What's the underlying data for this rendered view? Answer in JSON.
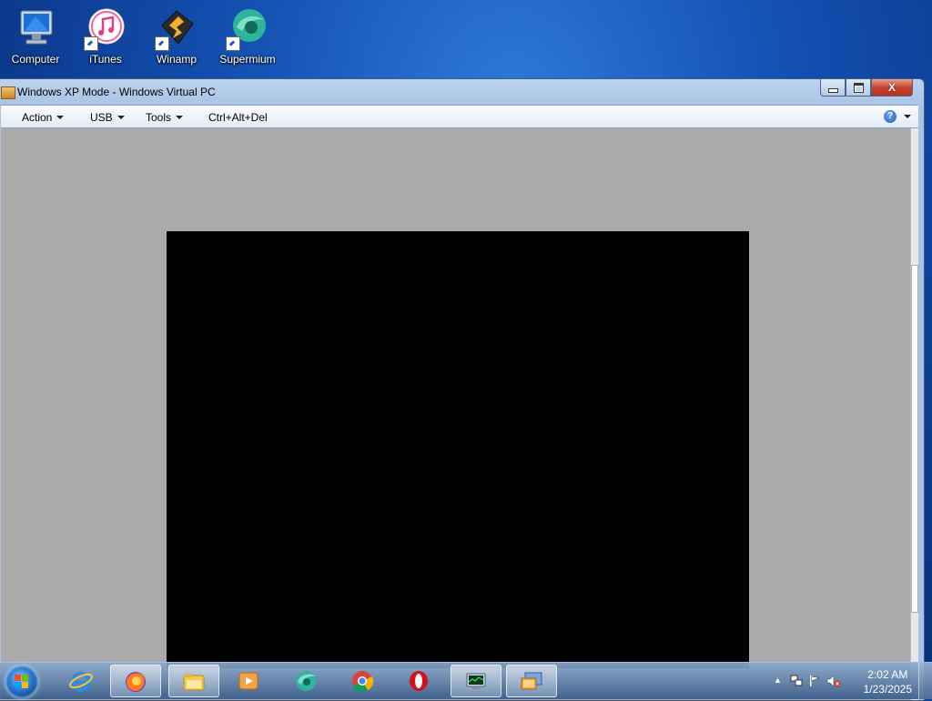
{
  "desktop": {
    "icons": [
      {
        "label": "Computer"
      },
      {
        "label": "iTunes"
      },
      {
        "label": "Winamp"
      },
      {
        "label": "Supermium"
      }
    ]
  },
  "window": {
    "title": "Windows XP Mode - Windows Virtual PC",
    "menu": {
      "action": "Action",
      "usb": "USB",
      "tools": "Tools",
      "cad": "Ctrl+Alt+Del"
    },
    "help_symbol": "?",
    "close_symbol": "X"
  },
  "taskbar": {
    "apps": [
      {
        "name": "internet-explorer-icon"
      },
      {
        "name": "firefox-icon"
      },
      {
        "name": "file-explorer-icon"
      },
      {
        "name": "media-player-icon"
      },
      {
        "name": "supermium-icon"
      },
      {
        "name": "chrome-icon"
      },
      {
        "name": "opera-icon"
      },
      {
        "name": "task-manager-icon"
      },
      {
        "name": "virtual-pc-icon"
      }
    ],
    "clock": {
      "time": "2:02 AM",
      "date": "1/23/2025"
    },
    "tray_chevron": "▲"
  },
  "colors": {
    "desktop_bg": "#1553b5",
    "vm_bg": "#aaaaaa",
    "vm_screen": "#000000"
  }
}
